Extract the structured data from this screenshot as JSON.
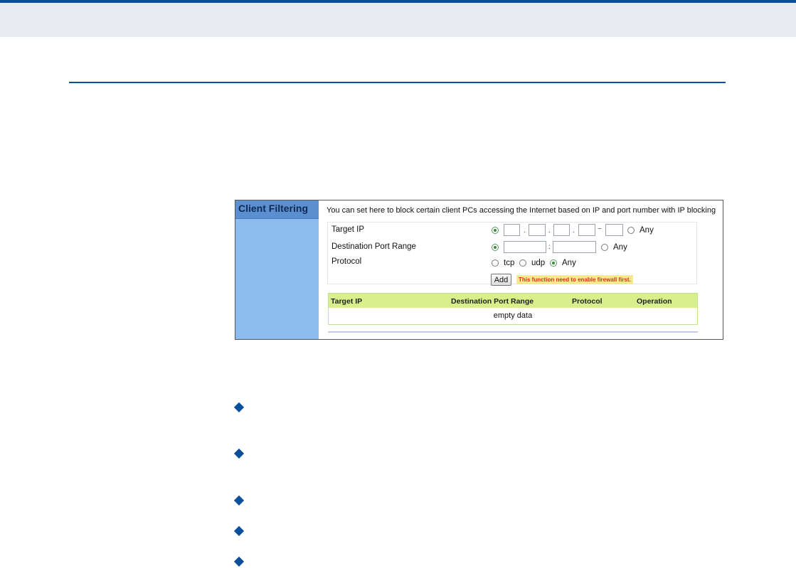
{
  "figure": {
    "side_title": "Client Filtering",
    "intro": "You can set here to block certain client PCs accessing the Internet based on IP and port number with IP blocking",
    "rows": {
      "target_ip": "Target IP",
      "dest_port_range": "Destination Port Range",
      "protocol": "Protocol"
    },
    "options": {
      "any": "Any",
      "tcp": "tcp",
      "udp": "udp",
      "dot": ".",
      "tilde": "~",
      "colon": ":"
    },
    "add_label": "Add",
    "warning": "This function need to enable firewall first.",
    "table": {
      "headers": [
        "Target IP",
        "Destination Port Range",
        "Protocol",
        "Operation"
      ],
      "empty": "empty data"
    },
    "colors": {
      "brand_blue": "#0a4f9c",
      "sidebar": "#8cbcf0",
      "table_header": "#d8f08c",
      "warning_bg": "#f6ea8c",
      "warning_text": "#d8321c"
    }
  }
}
